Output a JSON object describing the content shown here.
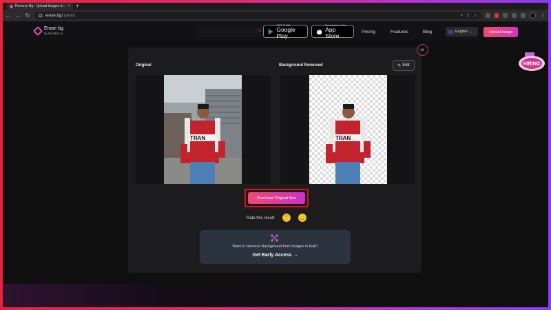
{
  "browser": {
    "tab_title": "Remove Bg - Upload Images to ...",
    "tab_close": "×",
    "new_tab": "+",
    "url_domain": "erase.bg",
    "url_path": "/upload"
  },
  "header": {
    "logo_name": "Erase bg",
    "logo_by": "by PixelBin.io",
    "google_play_small": "GET IT ON",
    "google_play_big": "Google Play",
    "app_store_small": "Download on the",
    "app_store_big": "App Store",
    "faint_text": "Or",
    "nav": [
      "Pricing",
      "Features",
      "Blog"
    ],
    "language": "English",
    "upload_button": "Upload Image"
  },
  "modal": {
    "original_label": "Original",
    "removed_label": "Background Removed",
    "edit_label": "Edit",
    "download_button": "Download Original Size",
    "rate_label": "Rate this result:",
    "bulk_text": "Want to Remove Background from Images in bulk?",
    "bulk_cta": "Get Early Access →",
    "close": "×"
  },
  "badge": {
    "hiring": "HIRING"
  },
  "colors": {
    "accent_start": "#f2486e",
    "accent_end": "#c932c9",
    "highlight_border": "#e01010",
    "modal_bg": "#1c1c1f"
  }
}
